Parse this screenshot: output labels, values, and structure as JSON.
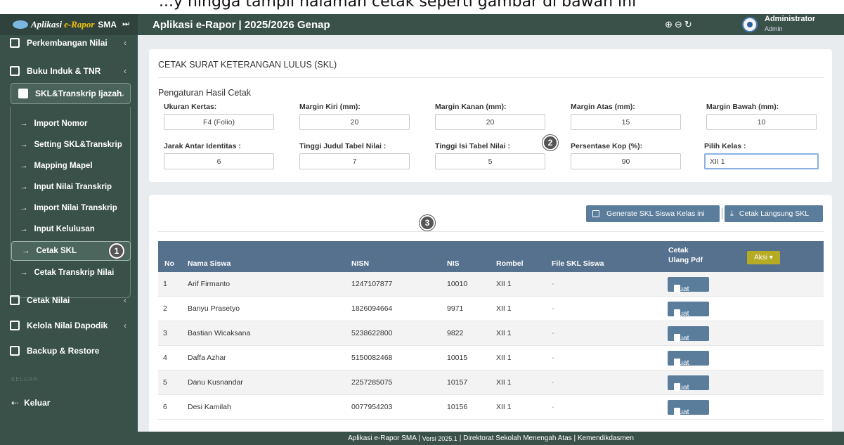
{
  "top_strip_text": "...y hingga tampil halaman cetak seperti gambar di bawah ini",
  "brand": {
    "part1": "Aplikasi",
    "part2": "e-Rapor",
    "part3": "SMA",
    "pin": "⏭"
  },
  "header": {
    "title": "Aplikasi e-Rapor | 2025/2026 Genap",
    "user_name": "Administrator",
    "user_role": "Admin"
  },
  "sidebar": {
    "items": [
      {
        "label": "Perkembangan Nilai",
        "chev": "‹"
      },
      {
        "label": "Buku Induk & TNR",
        "chev": "‹"
      },
      {
        "label": "SKL&Transkrip Ijazah",
        "chev": "⌄"
      }
    ],
    "sub_items": [
      {
        "label": "Import Nomor"
      },
      {
        "label": "Setting SKL&Transkrip"
      },
      {
        "label": "Mapping Mapel"
      },
      {
        "label": "Input Nilai Transkrip"
      },
      {
        "label": "Import Nilai Transkrip"
      },
      {
        "label": "Input Kelulusan"
      },
      {
        "label": "Cetak SKL"
      },
      {
        "label": "Cetak Transkrip Nilai"
      }
    ],
    "items2": [
      {
        "label": "Cetak Nilai",
        "chev": "‹"
      },
      {
        "label": "Kelola Nilai Dapodik",
        "chev": "‹"
      },
      {
        "label": "Backup & Restore"
      }
    ],
    "section_label": "KELUAR",
    "logout": "Keluar"
  },
  "print_card": {
    "title": "CETAK SURAT KETERANGAN LULUS (SKL)",
    "section": "Pengaturan Hasil Cetak",
    "fields": [
      {
        "label": "Ukuran Kertas:",
        "value": "F4 (Folio)"
      },
      {
        "label": "Margin Kiri (mm):",
        "value": "20"
      },
      {
        "label": "Margin Kanan (mm):",
        "value": "20"
      },
      {
        "label": "Margin Atas (mm):",
        "value": "15"
      },
      {
        "label": "Margin Bawah (mm):",
        "value": "10"
      },
      {
        "label": "Jarak Antar Identitas :",
        "value": "6"
      },
      {
        "label": "Tinggi Judul Tabel Nilai :",
        "value": "7"
      },
      {
        "label": "Tinggi Isi Tabel Nilai :",
        "value": "5"
      },
      {
        "label": "Persentase Kop (%):",
        "value": "90"
      },
      {
        "label": "Pilih Kelas :",
        "value": "XII 1"
      }
    ]
  },
  "badges": [
    "1",
    "2",
    "3"
  ],
  "buttons": {
    "generate": "Generate SKL Siswa Kelas ini",
    "print": "Cetak Langsung SKL",
    "print_icon": "⤓"
  },
  "table": {
    "headers": {
      "no": "No",
      "nama": "Nama Siswa",
      "nisn": "NISN",
      "nis": "NIS",
      "rombel": "Rombel",
      "file": "File SKL Siswa",
      "cetak1": "Cetak",
      "cetak2": "Ulang Pdf",
      "aksi": "Aksi ▾"
    },
    "rows": [
      {
        "no": "1",
        "nama": "Arif Firmanto",
        "nisn": "1247107877",
        "nis": "10010",
        "rombel": "XII 1",
        "file": "-",
        "btn": "Buat"
      },
      {
        "no": "2",
        "nama": "Banyu Prasetyo",
        "nisn": "1826094664",
        "nis": "9971",
        "rombel": "XII 1",
        "file": "-",
        "btn": "Buat"
      },
      {
        "no": "3",
        "nama": "Bastian Wicaksana",
        "nisn": "5238622800",
        "nis": "9822",
        "rombel": "XII 1",
        "file": "-",
        "btn": "Buat"
      },
      {
        "no": "4",
        "nama": "Daffa Azhar",
        "nisn": "5150082468",
        "nis": "10015",
        "rombel": "XII 1",
        "file": "-",
        "btn": "Buat"
      },
      {
        "no": "5",
        "nama": "Danu Kusnandar",
        "nisn": "2257285075",
        "nis": "10157",
        "rombel": "XII 1",
        "file": "-",
        "btn": "Buat"
      },
      {
        "no": "6",
        "nama": "Desi Kamilah",
        "nisn": "0077954203",
        "nis": "10156",
        "rombel": "XII 1",
        "file": "-",
        "btn": "Buat"
      }
    ]
  },
  "footer": {
    "left": "Aplikasi e-Rapor SMA |",
    "version": "Versi 2025.1",
    "right": "| Direktorat Sekolah Menengah Atas | Kemendikdasmen"
  }
}
